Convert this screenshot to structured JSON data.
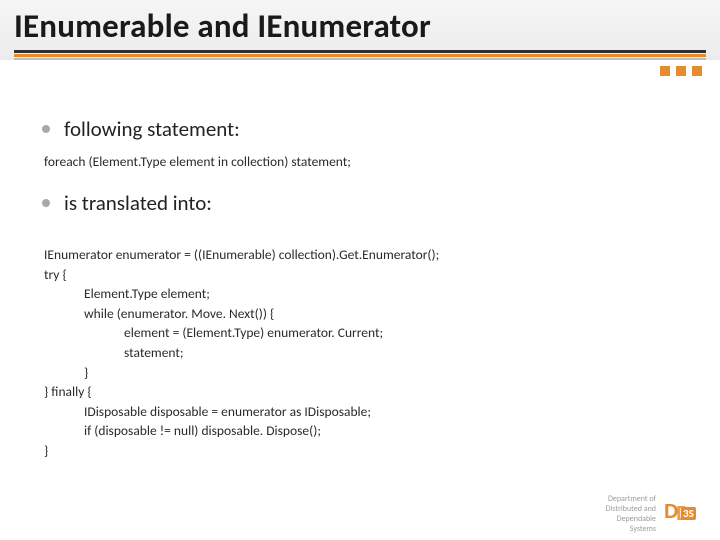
{
  "title": "IEnumerable and IEnumerator",
  "bullets": {
    "first": "following statement:",
    "second": "is translated into:"
  },
  "code_block_1": "foreach (Element.Type element in collection) statement;",
  "code_block_2": {
    "l0": "IEnumerator enumerator = ((IEnumerable) collection).Get.Enumerator();",
    "l1": "try {",
    "l2": "Element.Type element;",
    "l3": "while (enumerator. Move. Next()) {",
    "l4": "element = (Element.Type) enumerator. Current;",
    "l5": "statement;",
    "l6": "}",
    "l7": "} finally {",
    "l8": "IDisposable disposable = enumerator as IDisposable;",
    "l9": "if (disposable != null) disposable. Dispose();",
    "l10": "}"
  },
  "footer": {
    "line1": "Department of",
    "line2": "Distributed and",
    "line3": "Dependable",
    "line4": "Systems",
    "logo_text_d": "D",
    "logo_text_3s": "3S"
  }
}
